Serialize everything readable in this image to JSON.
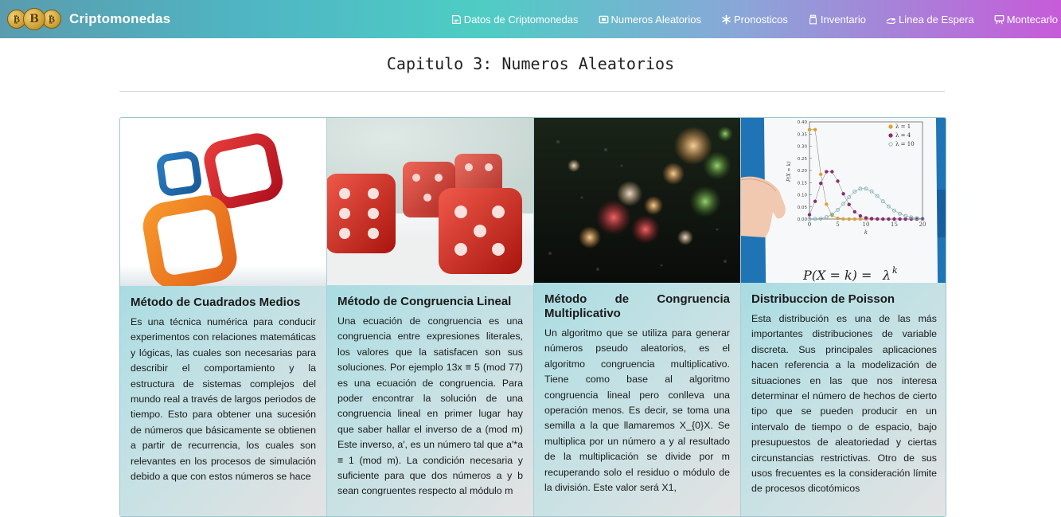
{
  "navbar": {
    "brand": "Criptomonedas",
    "coin_letters": [
      "₿",
      "B",
      "₿"
    ],
    "links": [
      {
        "label": "Datos de Criptomonedas",
        "icon": "document-icon"
      },
      {
        "label": "Numeros Aleatorios",
        "icon": "screen-icon"
      },
      {
        "label": "Pronosticos",
        "icon": "asterisk-icon"
      },
      {
        "label": "Inventario",
        "icon": "jar-icon"
      },
      {
        "label": "Linea de Espera",
        "icon": "hand-icon"
      },
      {
        "label": "Montecarlo",
        "icon": "easel-icon"
      }
    ]
  },
  "page": {
    "title": "Capitulo 3: Numeros Aleatorios"
  },
  "cards": [
    {
      "title": "Método de Cuadrados Medios",
      "text": "Es una técnica numérica para conducir experimentos con relaciones matemáticas y lógicas, las cuales son necesarias para describir el comportamiento y la estructura de sistemas complejos del mundo real a través de largos periodos de tiempo. Esto para obtener una sucesión de números que básicamente se obtienen a partir de recurrencia, los cuales son relevantes en los procesos de simulación debido a que con estos números se hace"
    },
    {
      "title": "Método de Congruencia Lineal",
      "text": "Una ecuación de congruencia es una congruencia entre expresiones literales, los valores que la satisfacen son sus soluciones. Por ejemplo 13x ≡ 5 (mod 77) es una ecuación de congruencia. Para poder encontrar la solución de una congruencia lineal en primer lugar hay que saber hallar el inverso de a (mod m) Este inverso, a′, es un número tal que a′*a ≡ 1 (mod m). La condición necesaria y suficiente para que dos números a y b sean congruentes respecto al módulo m"
    },
    {
      "title": "Método de Congruencia Multiplicativo",
      "text": "Un algoritmo que se utiliza para generar números pseudo aleatorios, es el algoritmo congruencia multiplicativo. Tiene como base al algoritmo congruencia lineal pero conlleva una operación menos. Es decir, se toma una semilla a la que llamaremos X_{0}X. Se multiplica por un número a y al resultado de la multiplicación se divide por m recuperando solo el residuo o módulo de la división. Este valor será X1,"
    },
    {
      "title": "Distribuccion de Poisson",
      "text": "Esta distribución es una de las más importantes distribuciones de variable discreta. Sus principales aplicaciones hacen referencia a la modelización de situaciones en las que nos interesa determinar el número de hechos de cierto tipo que se pueden producir en un intervalo de tiempo o de espacio, bajo presupuestos de aleatoriedad y ciertas circunstancias restrictivas. Otro de sus usos frecuentes es la consideración límite de procesos dicotómicos"
    }
  ],
  "poisson_image": {
    "legend": [
      "λ = 1",
      "λ = 4",
      "λ = 10"
    ],
    "y_ticks": [
      "0.40",
      "0.35",
      "0.30",
      "0.25",
      "0.20",
      "0.15",
      "0.10",
      "0.05",
      "0.00"
    ],
    "x_ticks": [
      "0",
      "5",
      "10",
      "15",
      "20"
    ],
    "x_label": "k",
    "y_label": "P(X = k)",
    "formula": "P(X = k) = λ^k",
    "formula_left": "P(X = k) =",
    "formula_right": "λ",
    "formula_exp": "k",
    "series_colors": [
      "#e0a030",
      "#8b2a78",
      "#7ab8b8"
    ],
    "series": [
      {
        "lambda": 1,
        "values": [
          0.368,
          0.368,
          0.184,
          0.061,
          0.015,
          0.003,
          0.0005,
          0.0001,
          0,
          0,
          0,
          0,
          0,
          0,
          0,
          0,
          0,
          0,
          0,
          0,
          0
        ]
      },
      {
        "lambda": 4,
        "values": [
          0.018,
          0.073,
          0.147,
          0.195,
          0.195,
          0.156,
          0.104,
          0.06,
          0.03,
          0.013,
          0.005,
          0.002,
          0.0006,
          0.0002,
          0,
          0,
          0,
          0,
          0,
          0,
          0
        ]
      },
      {
        "lambda": 10,
        "values": [
          5e-05,
          0.0005,
          0.002,
          0.008,
          0.019,
          0.038,
          0.063,
          0.09,
          0.113,
          0.125,
          0.125,
          0.114,
          0.095,
          0.073,
          0.052,
          0.035,
          0.022,
          0.013,
          0.007,
          0.004,
          0.002
        ]
      }
    ]
  }
}
